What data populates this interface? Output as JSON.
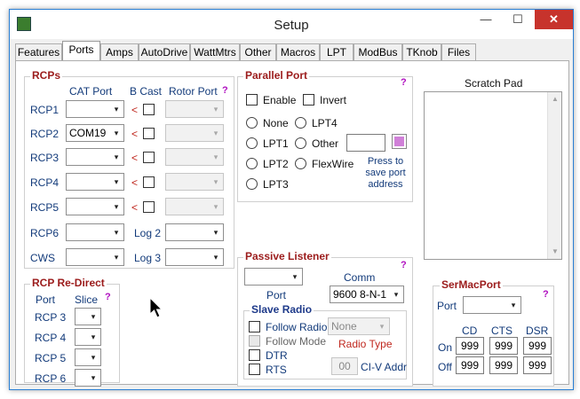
{
  "window": {
    "title": "Setup",
    "minimize": "—",
    "maximize": "☐",
    "close": "✕"
  },
  "tabs": [
    "Features",
    "Ports",
    "Amps",
    "AutoDrive",
    "WattMtrs",
    "Other",
    "Macros",
    "LPT",
    "ModBus",
    "TKnob",
    "Files"
  ],
  "active_tab": "Ports",
  "rcps": {
    "title": "RCPs",
    "hdr_cat": "CAT Port",
    "hdr_bcast": "B Cast",
    "hdr_rotor": "Rotor Port",
    "help": "?",
    "rows": [
      {
        "label": "RCP1",
        "cat": "",
        "arrow": "<"
      },
      {
        "label": "RCP2",
        "cat": "COM19",
        "arrow": "<"
      },
      {
        "label": "RCP3",
        "cat": "",
        "arrow": "<"
      },
      {
        "label": "RCP4",
        "cat": "",
        "arrow": "<"
      },
      {
        "label": "RCP5",
        "cat": "",
        "arrow": "<"
      }
    ],
    "rcp6": "RCP6",
    "cws": "CWS",
    "log2": "Log 2",
    "log3": "Log 3"
  },
  "redirect": {
    "title": "RCP Re-Direct",
    "hdr_port": "Port",
    "hdr_slice": "Slice",
    "help": "?",
    "rows": [
      "RCP 3",
      "RCP 4",
      "RCP 5",
      "RCP 6"
    ]
  },
  "parallel": {
    "title": "Parallel Port",
    "help": "?",
    "enable": "Enable",
    "invert": "Invert",
    "none": "None",
    "lpt4": "LPT4",
    "lpt1": "LPT1",
    "other": "Other",
    "lpt2": "LPT2",
    "flexwire": "FlexWire",
    "lpt3": "LPT3",
    "press": "Press to save port address",
    "other_value": ""
  },
  "scratch": {
    "title": "Scratch Pad",
    "up": "▲",
    "down": "▼"
  },
  "passive": {
    "title": "Passive Listener",
    "help": "?",
    "port_label": "Port",
    "comm_label": "Comm",
    "comm_value": "9600 8-N-1",
    "port_value": ""
  },
  "slave": {
    "title": "Slave Radio",
    "follow_radio": "Follow Radio",
    "follow_mode": "Follow Mode",
    "dtr": "DTR",
    "rts": "RTS",
    "radio_value": "None",
    "radio_type": "Radio Type",
    "civ_value": "00",
    "civ_label": "CI-V Addr"
  },
  "sermac": {
    "title": "SerMacPort",
    "help": "?",
    "port_label": "Port",
    "cd": "CD",
    "cts": "CTS",
    "dsr": "DSR",
    "on": "On",
    "off": "Off",
    "on_values": [
      "999",
      "999",
      "999"
    ],
    "off_values": [
      "999",
      "999",
      "999"
    ]
  },
  "arrow_glyph": "▾"
}
